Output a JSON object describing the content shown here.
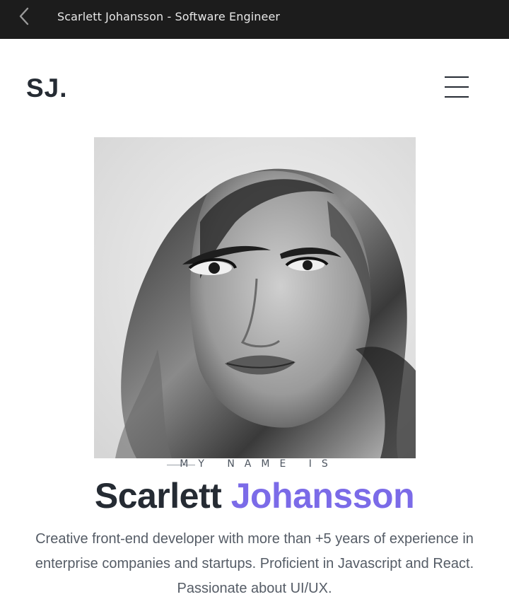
{
  "topbar": {
    "title": "Scarlett Johansson - Software Engineer",
    "back_icon": "chevron-left-icon"
  },
  "header": {
    "logo": "SJ.",
    "menu_icon": "hamburger-menu-icon"
  },
  "hero": {
    "eyebrow": "MY NAME IS",
    "first_name": "Scarlett",
    "last_name": "Johansson",
    "accent_color": "#7b6be8",
    "bio": "Creative front-end developer with more than +5 years of experience in enterprise companies and startups. Proficient in Javascript and React. Passionate about UI/UX."
  }
}
